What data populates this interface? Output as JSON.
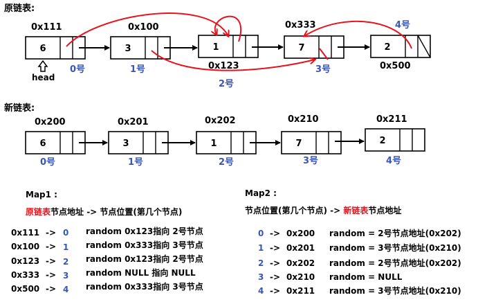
{
  "old_list": {
    "title": "原链表:",
    "head_label": "head",
    "nodes": [
      {
        "addr": "0x111",
        "val": "6",
        "idx": "0号"
      },
      {
        "addr": "0x100",
        "val": "3",
        "idx": "1号"
      },
      {
        "addr": "0x123",
        "val": "1",
        "idx": "2号"
      },
      {
        "addr": "0x333",
        "val": "7",
        "idx": "3号"
      },
      {
        "addr": "0x500",
        "val": "2",
        "idx": "4号"
      }
    ]
  },
  "new_list": {
    "title": "新链表:",
    "nodes": [
      {
        "addr": "0x200",
        "val": "6",
        "idx": "0号"
      },
      {
        "addr": "0x201",
        "val": "3",
        "idx": "1号"
      },
      {
        "addr": "0x202",
        "val": "1",
        "idx": "2号"
      },
      {
        "addr": "0x210",
        "val": "7",
        "idx": "3号"
      },
      {
        "addr": "0x211",
        "val": "2",
        "idx": "4号"
      }
    ]
  },
  "map1": {
    "title": "Map1 :",
    "sub_red": "原链表",
    "sub_rest": "节点地址 -> 节点位置(第几个节点)",
    "rows": [
      {
        "addr": "0x111",
        "arrow": "->",
        "num": "0",
        "desc": "random 0x123指向 2号节点"
      },
      {
        "addr": "0x100",
        "arrow": "->",
        "num": "1",
        "desc": "random 0x333指向 3号节点"
      },
      {
        "addr": "0x123",
        "arrow": "->",
        "num": "2",
        "desc": "random 0x123指向 2号节点"
      },
      {
        "addr": "0x333",
        "arrow": "->",
        "num": "3",
        "desc": "random NULL 指向 NULL"
      },
      {
        "addr": "0x500",
        "arrow": "->",
        "num": "4",
        "desc": "random 0x333指向 3号节点"
      }
    ]
  },
  "map2": {
    "title": "Map2 :",
    "sub_pre": "节点位置(第几个节点) -> ",
    "sub_red": "新链表",
    "sub_post": "节点地址",
    "rows": [
      {
        "num": "0",
        "arrow": "->",
        "addr": "0x200",
        "desc": "random = 2号节点地址(0x202)"
      },
      {
        "num": "1",
        "arrow": "->",
        "addr": "0x201",
        "desc": "random = 3号节点地址(0x210)"
      },
      {
        "num": "2",
        "arrow": "->",
        "addr": "0x202",
        "desc": "random = 2号节点地址(0x202)"
      },
      {
        "num": "3",
        "arrow": "->",
        "addr": "0x210",
        "desc": "random = NULL"
      },
      {
        "num": "4",
        "arrow": "->",
        "addr": "0x211",
        "desc": "random = 3号节点地址(0x210)"
      }
    ]
  },
  "colors": {
    "index_blue": "#3a55b4",
    "random_red": "#e8111c",
    "outline": "#000000"
  }
}
